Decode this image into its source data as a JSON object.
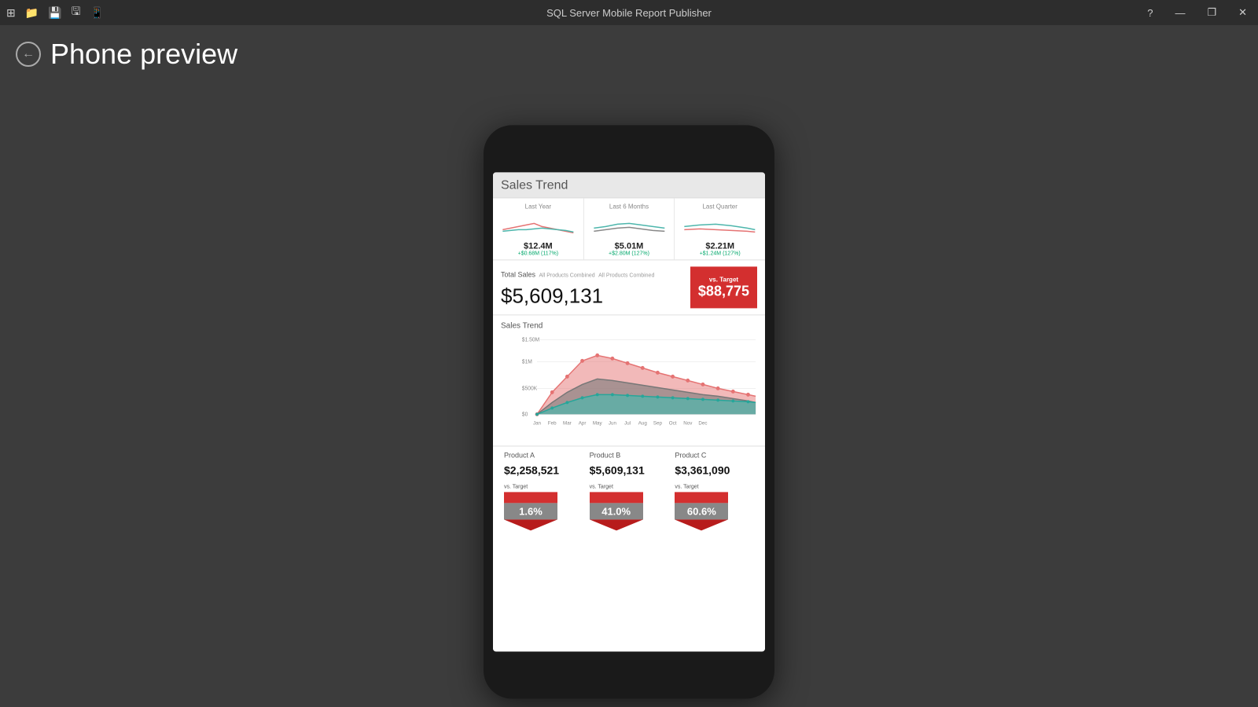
{
  "titlebar": {
    "title": "SQL Server Mobile Report Publisher",
    "icons": [
      "grid-icon",
      "folder-icon",
      "save-icon",
      "save-as-icon",
      "mobile-icon"
    ],
    "buttons": [
      "help-btn",
      "minimize-btn",
      "restore-btn",
      "close-btn"
    ],
    "help_label": "?",
    "minimize_label": "—",
    "restore_label": "❐",
    "close_label": "✕"
  },
  "page": {
    "title": "Phone preview",
    "back_label": "←"
  },
  "report": {
    "header_title": "Sales Trend",
    "mini_charts": [
      {
        "label": "Last Year",
        "value": "$12.4M",
        "delta": "+$0.68M (117%)"
      },
      {
        "label": "Last 6 Months",
        "value": "$5.01M",
        "delta": "+$2.80M (127%)"
      },
      {
        "label": "Last Quarter",
        "value": "$2.21M",
        "delta": "+$1.24M (127%)"
      }
    ],
    "total_sales_label": "Total Sales",
    "total_sales_sublabel": "All Products Combined",
    "total_sales_value": "$5,609,131",
    "vs_target_label": "vs. Target",
    "vs_target_value": "$88,775",
    "trend_chart_title": "Sales Trend",
    "trend_y_labels": [
      "$1.50M",
      "$1M",
      "$500K",
      "$0"
    ],
    "trend_x_labels": [
      "Jan",
      "Feb",
      "Mar",
      "Apr",
      "May",
      "Jun",
      "Jul",
      "Aug",
      "Sep",
      "Oct",
      "Nov",
      "Dec"
    ],
    "products": [
      {
        "name": "Product A",
        "value": "$2,258,521",
        "vs_target_label": "vs. Target",
        "badge": "1.6%"
      },
      {
        "name": "Product B",
        "value": "$5,609,131",
        "vs_target_label": "vs. Target",
        "badge": "41.0%"
      },
      {
        "name": "Product C",
        "value": "$3,361,090",
        "vs_target_label": "vs. Target",
        "badge": "60.6%"
      }
    ]
  }
}
